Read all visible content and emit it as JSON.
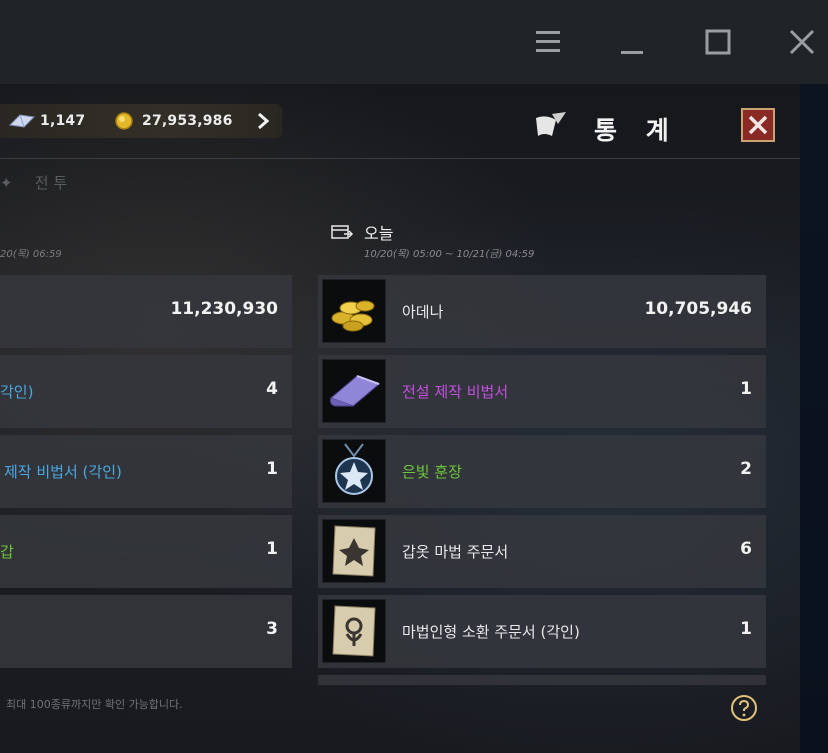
{
  "window_controls": {
    "menu_icon": "hamburger-icon",
    "minimize_icon": "minimize-icon",
    "maximize_icon": "maximize-icon",
    "close_icon": "close-icon"
  },
  "currency": {
    "crystal_amount": "1,147",
    "adena_amount": "27,953,986",
    "arrow_icon": "chevron-right-icon"
  },
  "header": {
    "title": "통 계",
    "title_icon": "scroll-quill-icon",
    "close_icon": "close-icon"
  },
  "tab": {
    "label": "전 투"
  },
  "left_column": {
    "date": "20(목) 06:59",
    "rows": [
      {
        "name": "",
        "value": "11,230,930",
        "name_color": "#e8e8e8"
      },
      {
        "name": "각인)",
        "value": "4",
        "name_color": "#4aa8e0"
      },
      {
        "name": "제작 비법서 (각인)",
        "value": "1",
        "name_color": "#4aa8e0"
      },
      {
        "name": "갑",
        "value": "1",
        "name_color": "#6ec63a"
      },
      {
        "name": "",
        "value": "3",
        "name_color": "#e8e8e8"
      }
    ]
  },
  "today": {
    "label": "오늘",
    "range": "10/20(목) 05:00 ~ 10/21(금) 04:59",
    "rows": [
      {
        "name": "아데나",
        "value": "10,705,946",
        "name_color": "#e8e8e8",
        "icon": "adena-coins-icon"
      },
      {
        "name": "전설 제작 비법서",
        "value": "1",
        "name_color": "#c44fe0",
        "icon": "legendary-recipe-icon"
      },
      {
        "name": "은빛 훈장",
        "value": "2",
        "name_color": "#6ec63a",
        "icon": "silver-medal-icon"
      },
      {
        "name": "갑옷 마법 주문서",
        "value": "6",
        "name_color": "#e8e8e8",
        "icon": "armor-scroll-icon"
      },
      {
        "name": "마법인형 소환 주문서 (각인)",
        "value": "1",
        "name_color": "#e8e8e8",
        "icon": "doll-summon-scroll-icon"
      }
    ]
  },
  "footer": {
    "note": "최대 100종류까지만 확인 가능합니다.",
    "help_icon": "help-icon"
  }
}
